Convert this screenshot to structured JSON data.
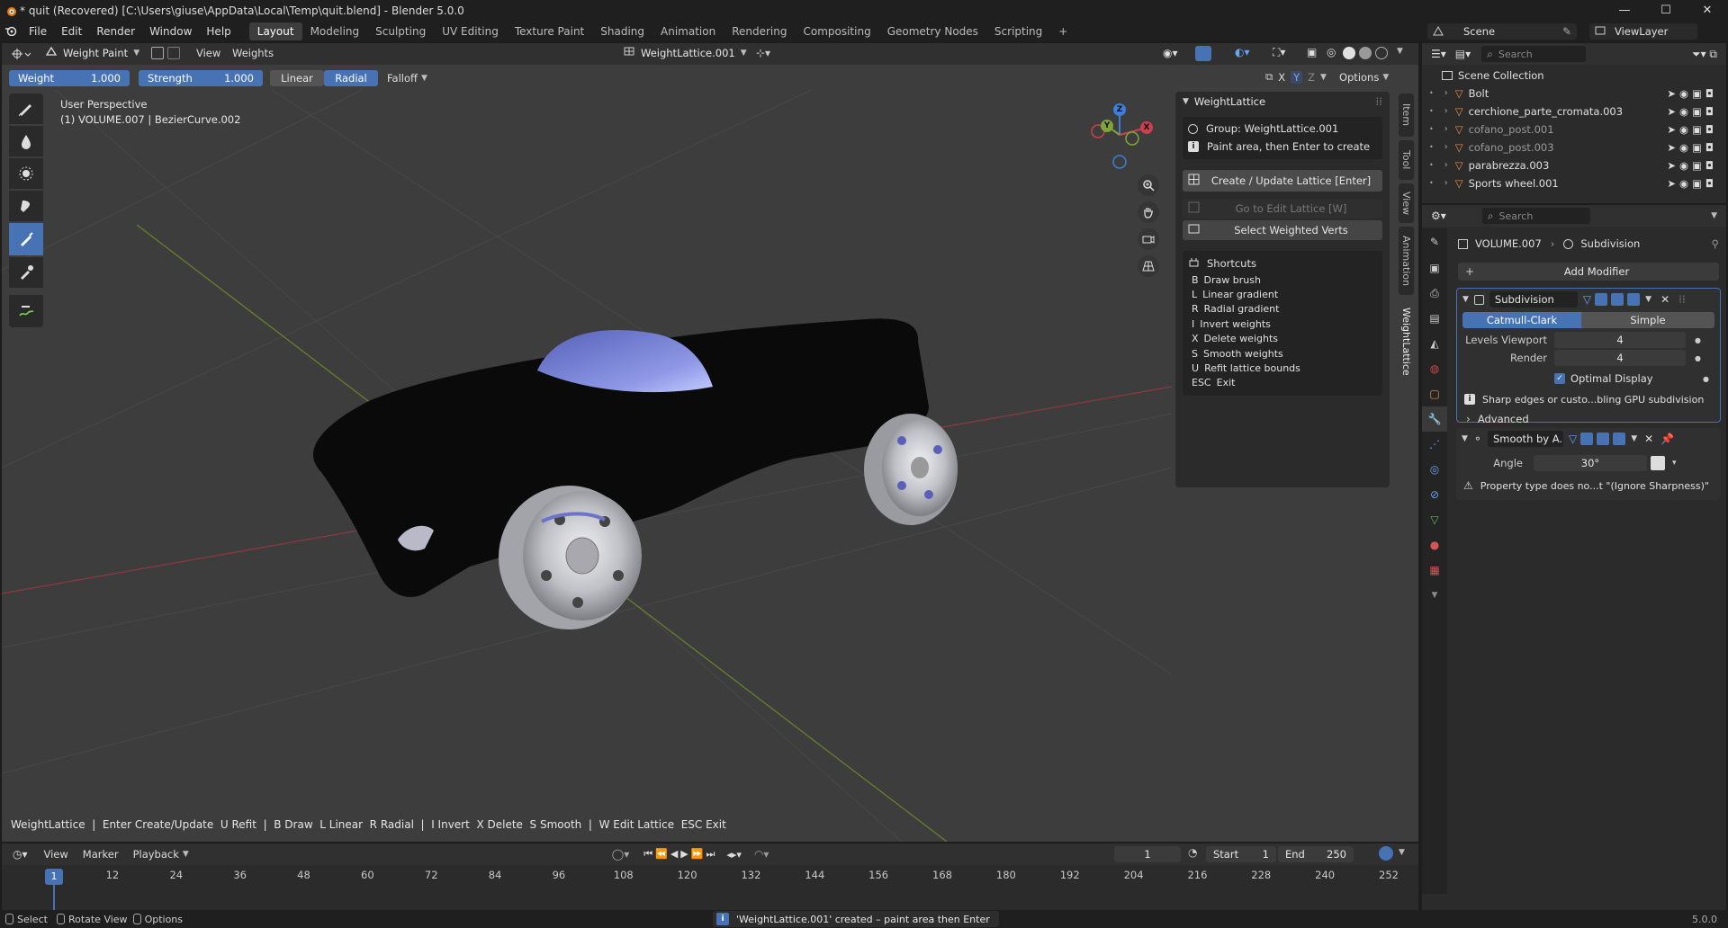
{
  "window": {
    "title": "* quit (Recovered) [C:\\Users\\giuse\\AppData\\Local\\Temp\\quit.blend] - Blender 5.0.0",
    "minimize": "—",
    "maximize": "☐",
    "close": "✕"
  },
  "menu": {
    "items": [
      "File",
      "Edit",
      "Render",
      "Window",
      "Help"
    ],
    "workspaces": [
      "Layout",
      "Modeling",
      "Sculpting",
      "UV Editing",
      "Texture Paint",
      "Shading",
      "Animation",
      "Rendering",
      "Compositing",
      "Geometry Nodes",
      "Scripting"
    ],
    "active_workspace": "Layout",
    "add_workspace": "+",
    "scene_label": "Scene",
    "viewlayer_label": "ViewLayer"
  },
  "viewport_header": {
    "mode": "Weight Paint",
    "view": "View",
    "weights": "Weights",
    "object_name": "WeightLattice.001"
  },
  "tool_settings": {
    "weight_label": "Weight",
    "weight_value": "1.000",
    "strength_label": "Strength",
    "strength_value": "1.000",
    "linear": "Linear",
    "radial": "Radial",
    "falloff": "Falloff",
    "options": "Options",
    "axes": [
      "X",
      "Y",
      "Z"
    ]
  },
  "viewport": {
    "perspective": "User Perspective",
    "object_info": "(1) VOLUME.007 | BezierCurve.002",
    "gizmo": {
      "x": "X",
      "y": "Y",
      "z": "Z"
    },
    "footer_hint": "WeightLattice  |  Enter Create/Update  U Refit  |  B Draw  L Linear  R Radial  |  I Invert  X Delete  S Smooth  |  W Edit Lattice  ESC Exit"
  },
  "sidebar_tabs": [
    "Item",
    "Tool",
    "View",
    "Animation",
    "WeightLattice"
  ],
  "weightlattice_panel": {
    "title": "WeightLattice",
    "group": "Group: WeightLattice.001",
    "info": "Paint area, then Enter to create",
    "create_button": "Create / Update Lattice  [Enter]",
    "goto_button": "Go to Edit Lattice  [W]",
    "select_button": "Select Weighted Verts",
    "shortcuts_title": "Shortcuts",
    "shortcuts": [
      {
        "key": "B",
        "label": "Draw brush"
      },
      {
        "key": "L",
        "label": "Linear gradient"
      },
      {
        "key": "R",
        "label": "Radial gradient"
      },
      {
        "key": "I",
        "label": "Invert weights"
      },
      {
        "key": "X",
        "label": "Delete weights"
      },
      {
        "key": "S",
        "label": "Smooth weights"
      },
      {
        "key": "U",
        "label": "Refit lattice bounds"
      },
      {
        "key": "ESC",
        "label": "Exit"
      }
    ]
  },
  "outliner": {
    "search_placeholder": "Search",
    "root": "Scene Collection",
    "items": [
      {
        "name": "Bolt",
        "dim": false
      },
      {
        "name": "cerchione_parte_cromata.003",
        "dim": false
      },
      {
        "name": "cofano_post.001",
        "dim": true
      },
      {
        "name": "cofano_post.003",
        "dim": true
      },
      {
        "name": "parabrezza.003",
        "dim": false
      },
      {
        "name": "Sports wheel.001",
        "dim": false
      }
    ]
  },
  "properties": {
    "search_placeholder": "Search",
    "breadcrumb_object": "VOLUME.007",
    "breadcrumb_modifier": "Subdivision",
    "add_modifier": "Add Modifier",
    "subdivision": {
      "name": "Subdivision",
      "catmull": "Catmull-Clark",
      "simple": "Simple",
      "levels_viewport_label": "Levels Viewport",
      "levels_viewport": "4",
      "render_label": "Render",
      "render": "4",
      "optimal_display": "Optimal Display",
      "warning": "Sharp edges or custo...bling GPU subdivision",
      "advanced": "Advanced"
    },
    "smooth": {
      "name": "Smooth by A...",
      "angle_label": "Angle",
      "angle": "30°",
      "warning": "Property type does no...t \"(Ignore Sharpness)\""
    }
  },
  "timeline": {
    "view": "View",
    "marker": "Marker",
    "playback": "Playback",
    "current_frame": "1",
    "start_label": "Start",
    "start": "1",
    "end_label": "End",
    "end": "250",
    "ticks": [
      "1",
      "12",
      "24",
      "36",
      "48",
      "60",
      "72",
      "84",
      "96",
      "108",
      "120",
      "132",
      "144",
      "156",
      "168",
      "180",
      "192",
      "204",
      "216",
      "228",
      "240",
      "252"
    ]
  },
  "statusbar": {
    "select": "Select",
    "rotate": "Rotate View",
    "options": "Options",
    "message": "'WeightLattice.001' created – paint area then Enter",
    "version": "5.0.0"
  },
  "colors": {
    "accent": "#4772b3",
    "viewport_bg": "#3d3d3d",
    "panel_bg": "#2b2b2b",
    "header_bg": "#303030",
    "x_axis": "#c84150",
    "y_axis": "#7ea43a",
    "z_axis": "#3d7fd6"
  }
}
